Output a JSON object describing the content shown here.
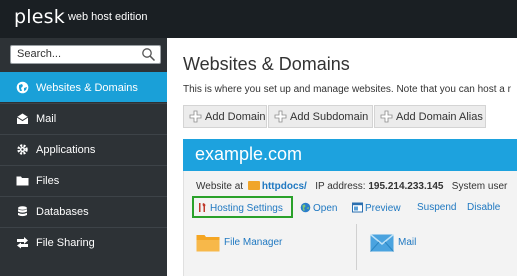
{
  "brand": {
    "name": "plesk",
    "edition": "web host edition"
  },
  "search": {
    "placeholder": "Search..."
  },
  "sidebar": {
    "items": [
      {
        "label": "Websites & Domains",
        "icon": "globe-icon",
        "active": true
      },
      {
        "label": "Mail",
        "icon": "mail-icon",
        "active": false
      },
      {
        "label": "Applications",
        "icon": "gear-icon",
        "active": false
      },
      {
        "label": "Files",
        "icon": "folder-icon",
        "active": false
      },
      {
        "label": "Databases",
        "icon": "database-icon",
        "active": false
      },
      {
        "label": "File Sharing",
        "icon": "share-icon",
        "active": false
      }
    ]
  },
  "main": {
    "title": "Websites & Domains",
    "description": "This is where you set up and manage websites. Note that you can host a r",
    "toolbar": [
      "Add Domain",
      "Add Subdomain",
      "Add Domain Alias"
    ],
    "domain": {
      "name": "example.com",
      "website_at_label": "Website at",
      "docroot": "httpdocs/",
      "ip_label": "IP address:",
      "ip": "195.214.233.145",
      "system_user_label": "System user"
    },
    "actions": [
      "Hosting Settings",
      "Open",
      "Preview",
      "Suspend",
      "Disable"
    ],
    "tools": [
      "File Manager",
      "Mail"
    ]
  },
  "colors": {
    "accent": "#1aa0d8",
    "highlight": "#2aa12a",
    "link": "#1f78c1",
    "sidebar": "#2d3236"
  }
}
